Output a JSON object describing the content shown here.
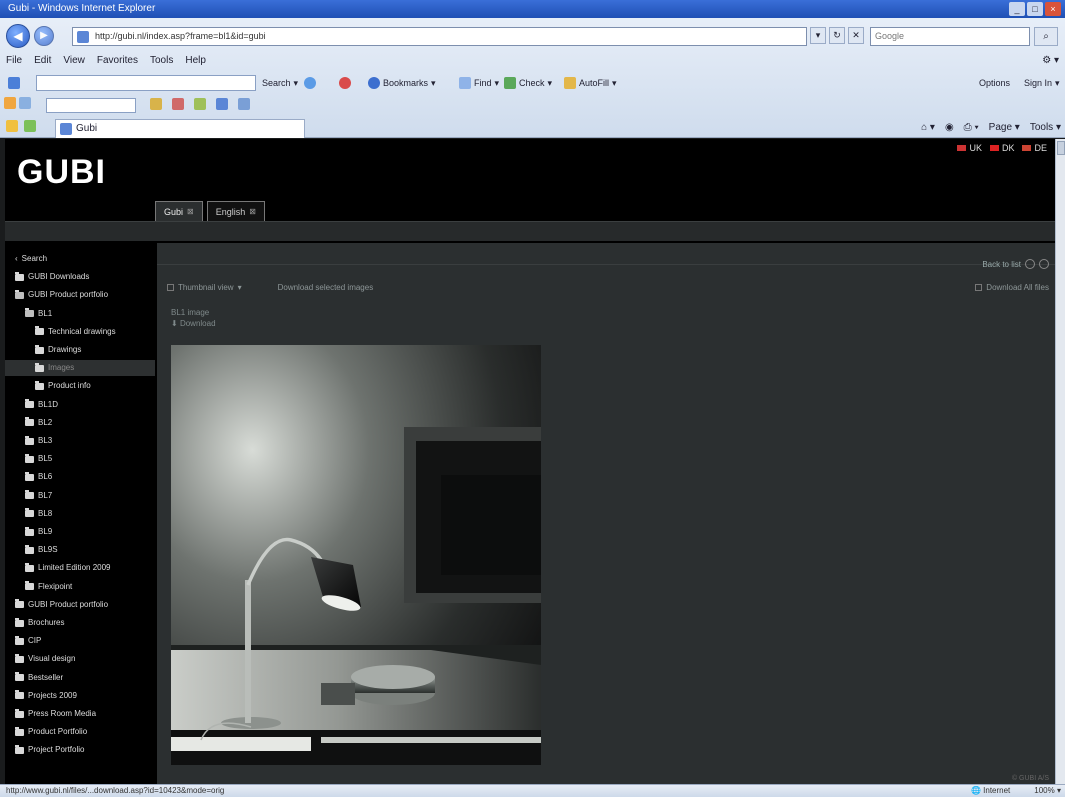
{
  "browser": {
    "title": "Gubi - Windows Internet Explorer",
    "address": "http://gubi.nl/index.asp?frame=bl1&id=gubi",
    "search_placeholder": "Google",
    "menu": [
      "File",
      "Edit",
      "View",
      "Favorites",
      "Tools",
      "Help"
    ],
    "toolbar": {
      "search_label": "Search",
      "bookmarks_label": "Bookmarks",
      "find_label": "Find",
      "check_label": "Check",
      "autofill_label": "AutoFill",
      "options_label": "Options",
      "sign_in_label": "Sign In"
    },
    "tab_title": "Gubi",
    "tab_tools": {
      "page_label": "Page",
      "tools_label": "Tools"
    },
    "status_text": "http://www.gubi.nl/files/...download.asp?id=10423&mode=orig",
    "status_right": {
      "zone": "Internet",
      "zoom": "100%"
    }
  },
  "site": {
    "logo": "GUBI",
    "languages": [
      "UK",
      "DK",
      "DE"
    ],
    "tabs": [
      {
        "label": "Gubi"
      },
      {
        "label": "English"
      }
    ]
  },
  "sidebar": {
    "items": [
      {
        "label": "Search",
        "indent": 0,
        "kind": "link"
      },
      {
        "label": "GUBI Downloads",
        "indent": 0,
        "kind": "folder"
      },
      {
        "label": "GUBI Product portfolio",
        "indent": 0,
        "kind": "folder-open"
      },
      {
        "label": "BL1",
        "indent": 1,
        "kind": "folder-open"
      },
      {
        "label": "Technical drawings",
        "indent": 2,
        "kind": "folder"
      },
      {
        "label": "Drawings",
        "indent": 2,
        "kind": "folder"
      },
      {
        "label": "Images",
        "indent": 2,
        "kind": "folder",
        "selected": true
      },
      {
        "label": "Product info",
        "indent": 2,
        "kind": "folder"
      },
      {
        "label": "BL1D",
        "indent": 1,
        "kind": "folder"
      },
      {
        "label": "BL2",
        "indent": 1,
        "kind": "folder"
      },
      {
        "label": "BL3",
        "indent": 1,
        "kind": "folder"
      },
      {
        "label": "BL5",
        "indent": 1,
        "kind": "folder"
      },
      {
        "label": "BL6",
        "indent": 1,
        "kind": "folder"
      },
      {
        "label": "BL7",
        "indent": 1,
        "kind": "folder"
      },
      {
        "label": "BL8",
        "indent": 1,
        "kind": "folder"
      },
      {
        "label": "BL9",
        "indent": 1,
        "kind": "folder"
      },
      {
        "label": "BL9S",
        "indent": 1,
        "kind": "folder"
      },
      {
        "label": "Limited Edition 2009",
        "indent": 1,
        "kind": "folder"
      },
      {
        "label": "Flexipoint",
        "indent": 1,
        "kind": "folder"
      },
      {
        "label": "GUBI Product portfolio",
        "indent": 0,
        "kind": "folder"
      },
      {
        "label": "Brochures",
        "indent": 0,
        "kind": "folder"
      },
      {
        "label": "CIP",
        "indent": 0,
        "kind": "folder"
      },
      {
        "label": "Visual design",
        "indent": 0,
        "kind": "folder"
      },
      {
        "label": "Bestseller",
        "indent": 0,
        "kind": "folder"
      },
      {
        "label": "Projects 2009",
        "indent": 0,
        "kind": "folder"
      },
      {
        "label": "Press Room Media",
        "indent": 0,
        "kind": "folder"
      },
      {
        "label": "Product Portfolio",
        "indent": 0,
        "kind": "folder"
      },
      {
        "label": "Project Portfolio",
        "indent": 0,
        "kind": "folder"
      }
    ]
  },
  "content": {
    "pager": "Back to list",
    "toolbar": {
      "view_label": "Thumbnail view",
      "download_label": "Download selected images"
    },
    "download_all_label": "Download All files",
    "file_name": "BL1 image",
    "file_meta": "Download",
    "photo_alt": "Black desk lamp BL1 on a table beside a framed picture",
    "footer": "© GUBI A/S"
  },
  "colors": {
    "page_bg": "#000000",
    "content_bg": "#2b2f30",
    "sidebar_selected": "#2d3031",
    "accent": "#1f4fb4"
  }
}
